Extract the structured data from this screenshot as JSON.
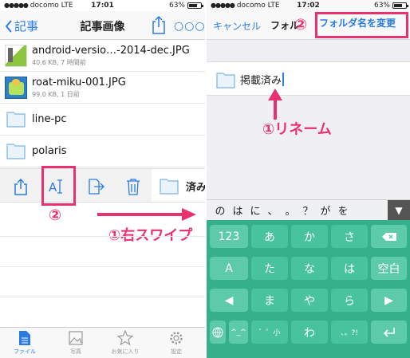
{
  "colors": {
    "accent": "#2a7be4",
    "highlight": "#e8326e",
    "keyboard": "#36b08b"
  },
  "left": {
    "status": {
      "carrier": "docomo",
      "network": "LTE",
      "time": "17:01",
      "battery": "63%"
    },
    "nav": {
      "back_label": "記事",
      "title": "記事画像"
    },
    "files": [
      {
        "name": "android-versio…-2014-dec.JPG",
        "meta": "40.6 KB, 7 時間前"
      },
      {
        "name": "roat-miku-001.JPG",
        "meta": "99.0 KB, 1 日前"
      }
    ],
    "folders": [
      {
        "name": "line-pc"
      },
      {
        "name": "polaris"
      }
    ],
    "swipe_folder_name": "済み",
    "annotations": {
      "step2": "②",
      "swipe": "①右スワイプ"
    },
    "tabs": [
      {
        "label": "ファイル",
        "icon": "file-icon"
      },
      {
        "label": "写真",
        "icon": "photo-icon"
      },
      {
        "label": "お気に入り",
        "icon": "star-icon"
      },
      {
        "label": "設定",
        "icon": "gear-icon"
      }
    ]
  },
  "right": {
    "status": {
      "carrier": "docomo",
      "network": "LTE",
      "time": "17:02",
      "battery": "63%"
    },
    "nav": {
      "cancel_label": "キャンセル",
      "title": "フォル",
      "rename_label": "フォルダ名を変更"
    },
    "input_value": "掲載済み",
    "annotations": {
      "step2": "②",
      "rename": "①リネーム"
    },
    "candidates": [
      "の",
      "は",
      "に",
      "、",
      "。",
      "？",
      "が",
      "を"
    ],
    "keys": {
      "row1": [
        "123",
        "あ",
        "か",
        "さ"
      ],
      "row2": [
        "A",
        "た",
        "な",
        "は",
        "空白"
      ],
      "row3": [
        "ま",
        "や",
        "ら"
      ],
      "row4_left": "^_^",
      "row4_mid": "゛゜小",
      "row4_wa": "わ",
      "row4_punct": "、。?!"
    }
  }
}
